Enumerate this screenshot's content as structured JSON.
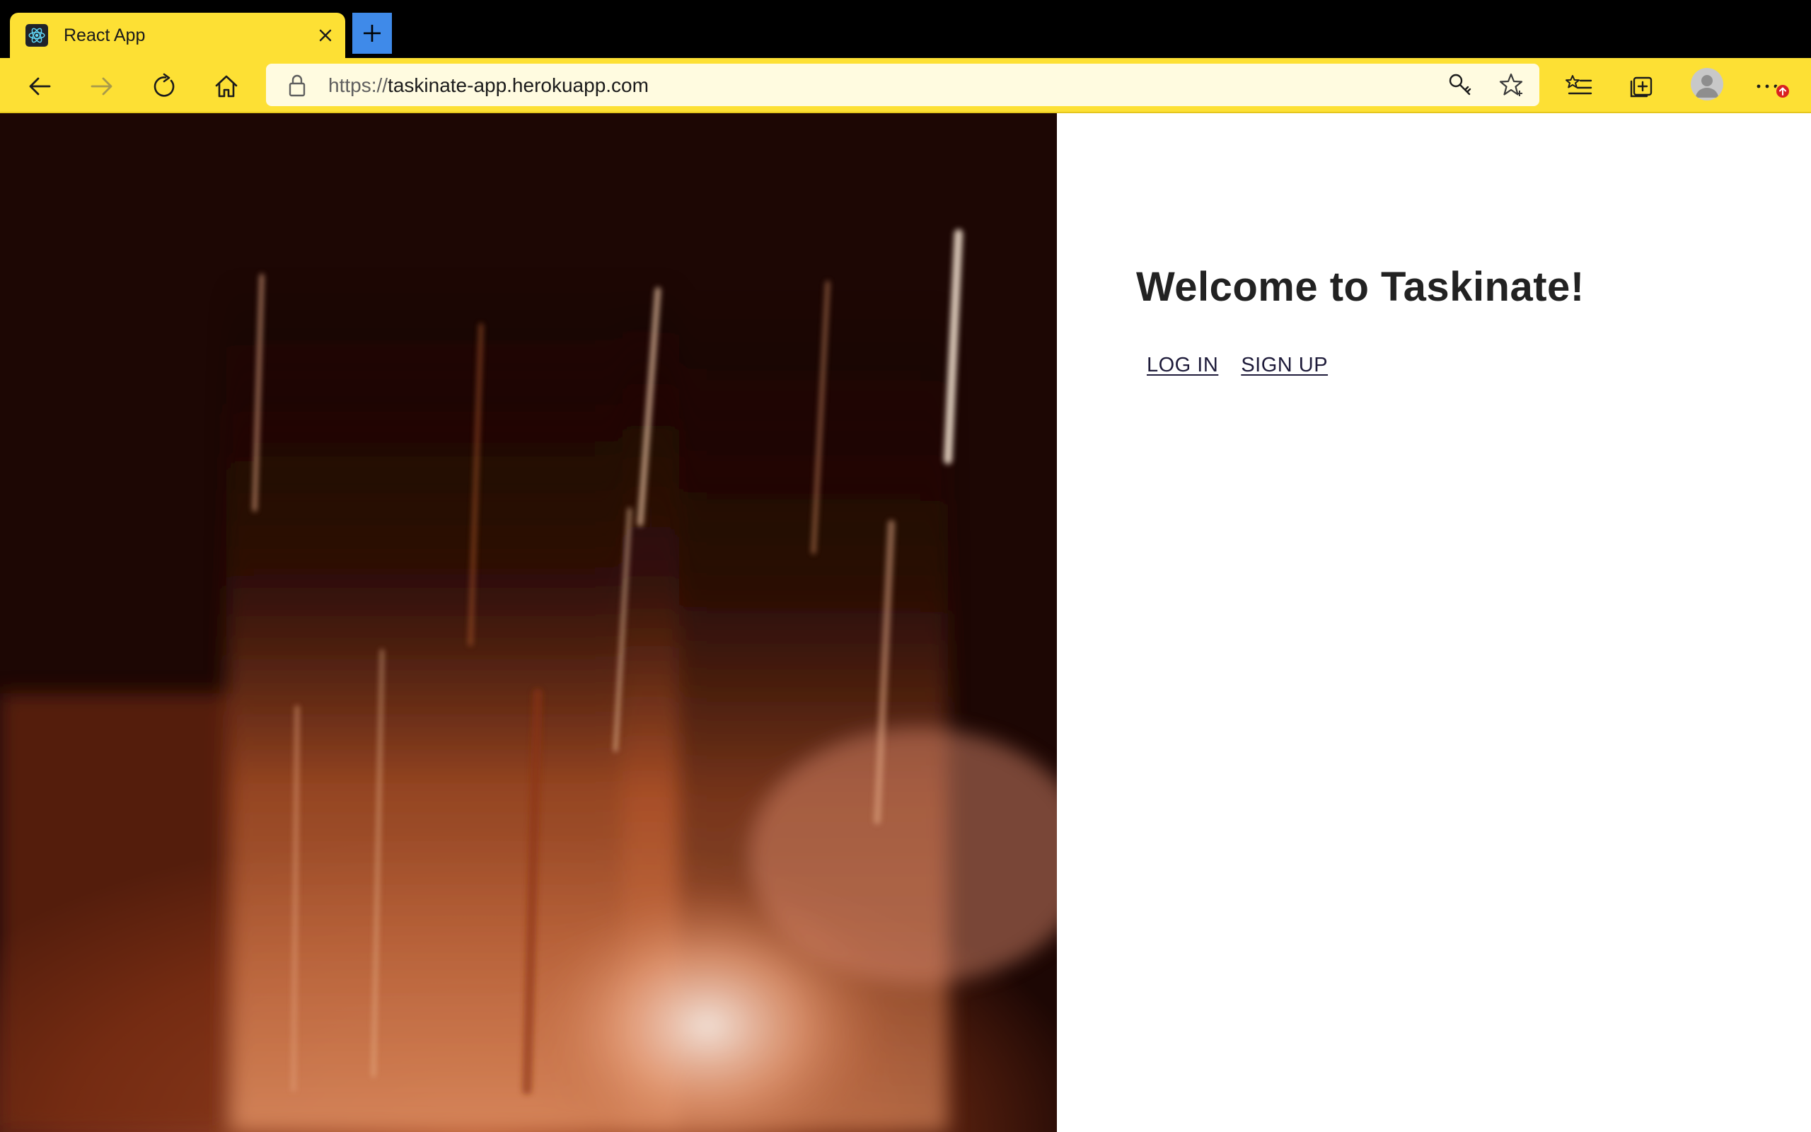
{
  "browser": {
    "tab": {
      "title": "React App",
      "favicon": "react-logo-icon"
    },
    "new_tab_icon": "plus-icon",
    "toolbar": {
      "back_icon": "back-arrow-icon",
      "forward_icon": "forward-arrow-icon",
      "refresh_icon": "refresh-icon",
      "home_icon": "home-icon",
      "favorites_icon": "favorites-list-icon",
      "collections_icon": "collections-icon",
      "profile_icon": "profile-avatar-icon",
      "menu_icon": "more-menu-icon"
    },
    "address_bar": {
      "protocol": "https://",
      "host": "taskinate-app.herokuapp.com",
      "lock_icon": "lock-icon",
      "key_icon": "key-icon",
      "star_icon": "star-add-icon"
    },
    "colors": {
      "theme": "#fde034",
      "new_tab": "#3f8ae9",
      "badge": "#d92121"
    }
  },
  "page": {
    "heading": "Welcome to Taskinate!",
    "links": {
      "login": "LOG IN",
      "signup": "SIGN UP"
    }
  }
}
